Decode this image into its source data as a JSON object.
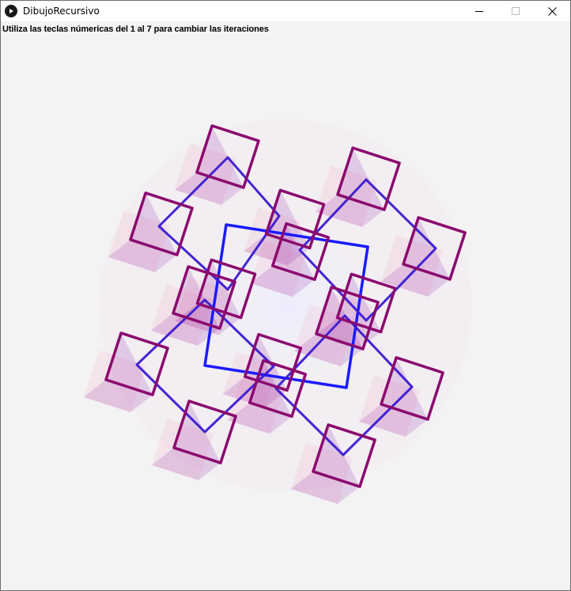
{
  "window": {
    "title": "DibujoRecursivo",
    "icon": "play-circle-icon",
    "controls": [
      "minimize-icon",
      "maximize-icon",
      "close-icon"
    ]
  },
  "canvas": {
    "instruction": "Utiliza las teclas númericas del 1 al 7 para cambiar las iteraciones",
    "background": "#f3f3f3",
    "colors": {
      "trunk": "#1a1aff",
      "square_outline": "#8b0a6e",
      "square_shade": "#7a0aa0",
      "fade_edge": "#ff3a7a",
      "glow": "#e8e8ff"
    }
  }
}
